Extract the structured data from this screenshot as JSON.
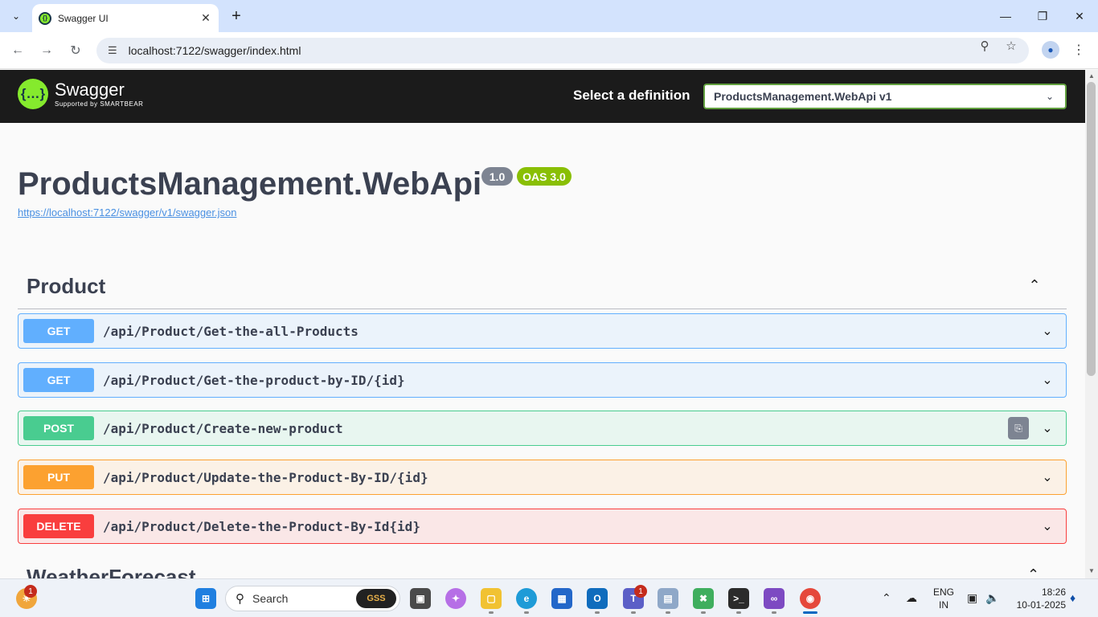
{
  "browser": {
    "tab_title": "Swagger UI",
    "url": "localhost:7122/swagger/index.html"
  },
  "swagger": {
    "logo_main": "Swagger",
    "logo_sub": "Supported by SMARTBEAR",
    "definition_label": "Select a definition",
    "definition_value": "ProductsManagement.WebApi v1",
    "api_title": "ProductsManagement.WebApi",
    "version_badge": "1.0",
    "oas_badge": "OAS 3.0",
    "spec_url": "https://localhost:7122/swagger/v1/swagger.json",
    "sections": [
      {
        "title": "Product",
        "operations": [
          {
            "method": "GET",
            "path": "/api/Product/Get-the-all-Products"
          },
          {
            "method": "GET",
            "path": "/api/Product/Get-the-product-by-ID/{id}"
          },
          {
            "method": "POST",
            "path": "/api/Product/Create-new-product"
          },
          {
            "method": "PUT",
            "path": "/api/Product/Update-the-Product-By-ID/{id}"
          },
          {
            "method": "DELETE",
            "path": "/api/Product/Delete-the-Product-By-Id{id}"
          }
        ]
      },
      {
        "title": "WeatherForecast"
      }
    ],
    "colors": {
      "get": "#61affe",
      "post": "#49cc90",
      "put": "#fca130",
      "delete": "#f93e3e",
      "brand": "#85ea2d",
      "topbar": "#1b1b1b"
    }
  },
  "taskbar": {
    "search_placeholder": "Search",
    "search_badge": "GSS",
    "widgets_badge": "1",
    "teams_badge": "1",
    "language": "ENG",
    "region": "IN",
    "time": "18:26",
    "date": "10-01-2025"
  }
}
